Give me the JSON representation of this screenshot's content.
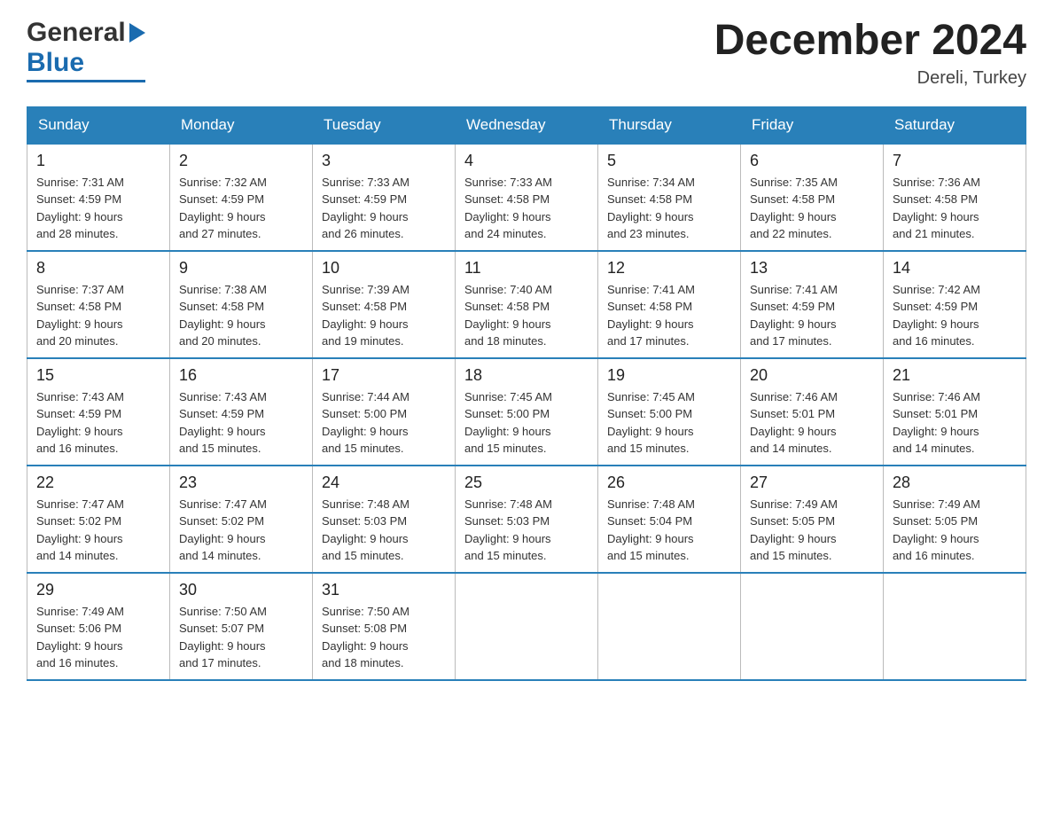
{
  "header": {
    "logo": {
      "general": "General",
      "blue": "Blue",
      "tagline": ""
    },
    "title": "December 2024",
    "location": "Dereli, Turkey"
  },
  "weekdays": [
    "Sunday",
    "Monday",
    "Tuesday",
    "Wednesday",
    "Thursday",
    "Friday",
    "Saturday"
  ],
  "weeks": [
    [
      {
        "day": "1",
        "sunrise": "7:31 AM",
        "sunset": "4:59 PM",
        "daylight": "9 hours and 28 minutes."
      },
      {
        "day": "2",
        "sunrise": "7:32 AM",
        "sunset": "4:59 PM",
        "daylight": "9 hours and 27 minutes."
      },
      {
        "day": "3",
        "sunrise": "7:33 AM",
        "sunset": "4:59 PM",
        "daylight": "9 hours and 26 minutes."
      },
      {
        "day": "4",
        "sunrise": "7:33 AM",
        "sunset": "4:58 PM",
        "daylight": "9 hours and 24 minutes."
      },
      {
        "day": "5",
        "sunrise": "7:34 AM",
        "sunset": "4:58 PM",
        "daylight": "9 hours and 23 minutes."
      },
      {
        "day": "6",
        "sunrise": "7:35 AM",
        "sunset": "4:58 PM",
        "daylight": "9 hours and 22 minutes."
      },
      {
        "day": "7",
        "sunrise": "7:36 AM",
        "sunset": "4:58 PM",
        "daylight": "9 hours and 21 minutes."
      }
    ],
    [
      {
        "day": "8",
        "sunrise": "7:37 AM",
        "sunset": "4:58 PM",
        "daylight": "9 hours and 20 minutes."
      },
      {
        "day": "9",
        "sunrise": "7:38 AM",
        "sunset": "4:58 PM",
        "daylight": "9 hours and 20 minutes."
      },
      {
        "day": "10",
        "sunrise": "7:39 AM",
        "sunset": "4:58 PM",
        "daylight": "9 hours and 19 minutes."
      },
      {
        "day": "11",
        "sunrise": "7:40 AM",
        "sunset": "4:58 PM",
        "daylight": "9 hours and 18 minutes."
      },
      {
        "day": "12",
        "sunrise": "7:41 AM",
        "sunset": "4:58 PM",
        "daylight": "9 hours and 17 minutes."
      },
      {
        "day": "13",
        "sunrise": "7:41 AM",
        "sunset": "4:59 PM",
        "daylight": "9 hours and 17 minutes."
      },
      {
        "day": "14",
        "sunrise": "7:42 AM",
        "sunset": "4:59 PM",
        "daylight": "9 hours and 16 minutes."
      }
    ],
    [
      {
        "day": "15",
        "sunrise": "7:43 AM",
        "sunset": "4:59 PM",
        "daylight": "9 hours and 16 minutes."
      },
      {
        "day": "16",
        "sunrise": "7:43 AM",
        "sunset": "4:59 PM",
        "daylight": "9 hours and 15 minutes."
      },
      {
        "day": "17",
        "sunrise": "7:44 AM",
        "sunset": "5:00 PM",
        "daylight": "9 hours and 15 minutes."
      },
      {
        "day": "18",
        "sunrise": "7:45 AM",
        "sunset": "5:00 PM",
        "daylight": "9 hours and 15 minutes."
      },
      {
        "day": "19",
        "sunrise": "7:45 AM",
        "sunset": "5:00 PM",
        "daylight": "9 hours and 15 minutes."
      },
      {
        "day": "20",
        "sunrise": "7:46 AM",
        "sunset": "5:01 PM",
        "daylight": "9 hours and 14 minutes."
      },
      {
        "day": "21",
        "sunrise": "7:46 AM",
        "sunset": "5:01 PM",
        "daylight": "9 hours and 14 minutes."
      }
    ],
    [
      {
        "day": "22",
        "sunrise": "7:47 AM",
        "sunset": "5:02 PM",
        "daylight": "9 hours and 14 minutes."
      },
      {
        "day": "23",
        "sunrise": "7:47 AM",
        "sunset": "5:02 PM",
        "daylight": "9 hours and 14 minutes."
      },
      {
        "day": "24",
        "sunrise": "7:48 AM",
        "sunset": "5:03 PM",
        "daylight": "9 hours and 15 minutes."
      },
      {
        "day": "25",
        "sunrise": "7:48 AM",
        "sunset": "5:03 PM",
        "daylight": "9 hours and 15 minutes."
      },
      {
        "day": "26",
        "sunrise": "7:48 AM",
        "sunset": "5:04 PM",
        "daylight": "9 hours and 15 minutes."
      },
      {
        "day": "27",
        "sunrise": "7:49 AM",
        "sunset": "5:05 PM",
        "daylight": "9 hours and 15 minutes."
      },
      {
        "day": "28",
        "sunrise": "7:49 AM",
        "sunset": "5:05 PM",
        "daylight": "9 hours and 16 minutes."
      }
    ],
    [
      {
        "day": "29",
        "sunrise": "7:49 AM",
        "sunset": "5:06 PM",
        "daylight": "9 hours and 16 minutes."
      },
      {
        "day": "30",
        "sunrise": "7:50 AM",
        "sunset": "5:07 PM",
        "daylight": "9 hours and 17 minutes."
      },
      {
        "day": "31",
        "sunrise": "7:50 AM",
        "sunset": "5:08 PM",
        "daylight": "9 hours and 18 minutes."
      },
      null,
      null,
      null,
      null
    ]
  ],
  "labels": {
    "sunrise": "Sunrise:",
    "sunset": "Sunset:",
    "daylight": "Daylight:"
  }
}
